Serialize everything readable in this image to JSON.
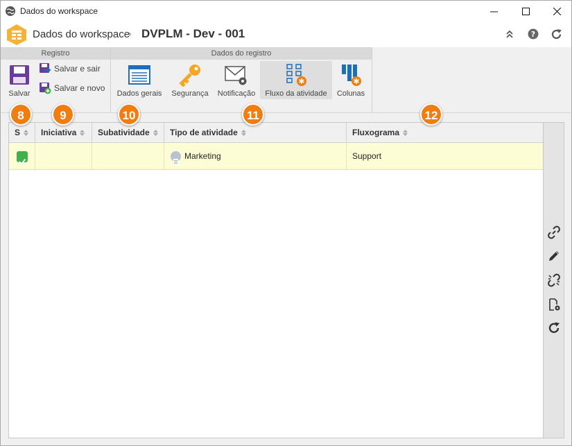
{
  "window": {
    "title": "Dados do workspace"
  },
  "header": {
    "breadcrumb_root": "Dados do workspace",
    "separator": "›",
    "current": "DVPLM - Dev - 001"
  },
  "ribbon": {
    "group_registro": "Registro",
    "group_dados": "Dados do registro",
    "salvar": "Salvar",
    "salvar_sair": "Salvar e sair",
    "salvar_novo": "Salvar e novo",
    "dados_gerais": "Dados gerais",
    "seguranca": "Segurança",
    "notificacao": "Notificação",
    "fluxo_atividade": "Fluxo da atividade",
    "colunas": "Colunas"
  },
  "table": {
    "columns": [
      "S",
      "Iniciativa",
      "Subatividade",
      "Tipo de atividade",
      "Fluxograma"
    ],
    "rows": [
      {
        "s": "checked",
        "iniciativa": "",
        "subatividade": "",
        "tipo": "Marketing",
        "fluxograma": "Support"
      }
    ]
  },
  "badges": [
    "8",
    "9",
    "10",
    "11",
    "12"
  ],
  "colors": {
    "accent": "#f07d10",
    "row_highlight": "#fdfdd5",
    "check": "#3fb04a",
    "purple": "#6a3d9a",
    "blue": "#1d6fb8"
  }
}
